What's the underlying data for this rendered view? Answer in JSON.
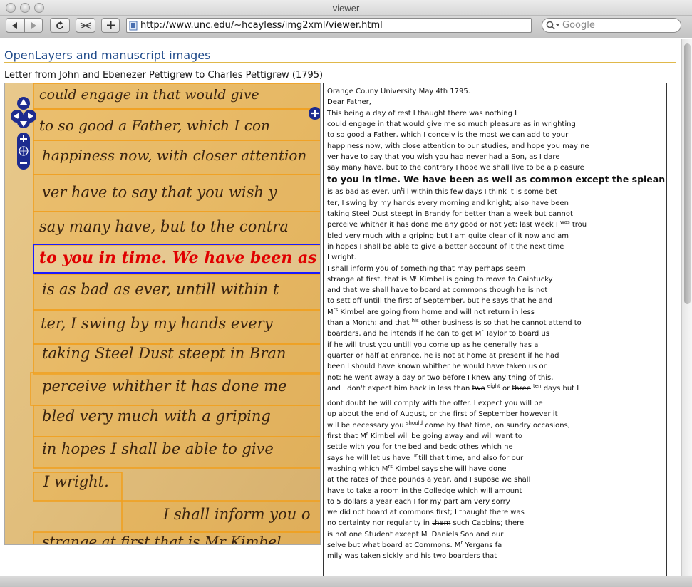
{
  "window": {
    "title": "viewer"
  },
  "toolbar": {
    "url": "http://www.unc.edu/~hcayless/img2xml/viewer.html",
    "search_placeholder": "Google"
  },
  "page": {
    "heading": "OpenLayers and manuscript images",
    "subtitle": "Letter from John and Ebenezer Pettigrew to Charles Pettigrew (1795)"
  },
  "manuscript": {
    "lines": [
      "could engage in that would give",
      "to so good a Father, which I con",
      "happiness now, with closer attention",
      "ver have to say that you wish y",
      "say many have, but to the contra",
      "to you in time. We have been as w",
      "is as bad as ever, untill within t",
      "ter, I swing by my hands every",
      "taking Steel Dust steept in Bran",
      "perceive whither it has done me",
      "bled very much with a griping",
      "in hopes I shall be able to give",
      "I wright.",
      "I shall inform you o",
      "strange at first that is Mr Kimbel"
    ]
  },
  "transcript": {
    "block1": [
      "Orange Couny University May 4th 1795.",
      "Dear Father,",
      "This being a day of rest I thaught there was nothing I",
      "could engage in that would give me so much pleasure as in wrighting",
      "to so good a Father, which I conceiv is the most we can add to your",
      "happiness now, with close attention to our studies, and hope you may ne",
      "ver have to say that you wish you had never had a Son, as I dare",
      "say many have, but to the contrary I hope we shall live to be a pleasure"
    ],
    "highlight": "to you in time. We have been as well as common except the splean which",
    "line_untill_a": "is as bad as ever, un",
    "line_untill_sup": "t",
    "line_untill_b": "ill within this few days I think it is some bet",
    "block2": [
      "ter, I swing by my hands every morning and knight; also have been",
      "taking Steel Dust steept in Brandy for better than a week but cannot"
    ],
    "line_was_a": "perceive whither it has done me any good or not yet; last week I ",
    "line_was_sup": "was",
    "line_was_b": " trou",
    "block3": [
      "bled very much with a griping but I am quite clear of it now and am",
      "in hopes I shall be able to give a better account of it the next time",
      "I wright.",
      "I shall inform you of something that may perhaps seem"
    ],
    "line_kimbel_a": "strange at first, that is M",
    "line_kimbel_sup": "r",
    "line_kimbel_b": " Kimbel is going to move to Caintucky",
    "block4": [
      "and that we shall have to board at commons though he is not",
      "to sett off untill the first of September, but he says that he and"
    ],
    "line_mrs_a": "M",
    "line_mrs_sup": "rs",
    "line_mrs_b": " Kimbel are going from home and will not return in less",
    "line_his_a": "than a Month: and that ",
    "line_his_sup": "his",
    "line_his_b": " other business is so that he cannot attend to",
    "line_taylor_a": "boarders, and he intends if he can to get M",
    "line_taylor_sup": "r",
    "line_taylor_b": " Taylor to board us",
    "block5": [
      "if he will trust you untill you come up as he generally has a",
      "quarter or half at enrance, he is not at home at present if he had",
      "been I should have known whither he would have taken us or",
      "not; he went away a day or two before I knew any thing of this,"
    ],
    "line_two_a": "and I don't expect him back in less than ",
    "line_two_strike": "two",
    "line_two_sup1": "eight",
    "line_two_mid": " or ",
    "line_two_strike2": "three",
    "line_two_sup2": "ten",
    "line_two_b": " days but I",
    "block6": [
      "dont doubt he will comply with the offer. I expect you will be",
      "up about the end of August, or the first of September however it"
    ],
    "line_should_a": "will be necessary you ",
    "line_should_sup": "should",
    "line_should_b": " come by that time, on sundry occasions,",
    "line_first_a": "first that M",
    "line_first_sup": "r",
    "line_first_b": " Kimbel will be going away and will want to",
    "block7": [
      "settle with you for the bed and bedclothes which he"
    ],
    "line_un_a": "says he will let us have ",
    "line_un_sup": "un",
    "line_un_b": "till that time, and also for our",
    "line_wash_a": "washing which M",
    "line_wash_sup": "rs",
    "line_wash_b": " Kimbel says she will have done",
    "block8": [
      "at the rates of thee pounds a year, and I supose we shall",
      "have to take a room in the Colledge which will amount",
      "to 5 dollars a year each I for my part am very sorry",
      "we did not board at commons first; I thaught there was"
    ],
    "line_them_a": "no certainty nor regularity in ",
    "line_them_strike": "them",
    "line_them_b": " such Cabbins; there",
    "line_daniels_a": "is not one Student except M",
    "line_daniels_sup": "r",
    "line_daniels_b": " Daniels Son and our",
    "line_yergans_a": "selve but what board at Commons. M",
    "line_yergans_sup": "r",
    "line_yergans_b": " Yergans fa",
    "block9": [
      "mily was taken sickly and his two boarders that"
    ]
  },
  "colors": {
    "heading": "#1f4a8a",
    "highlight_box": "#1a1aff",
    "line_box": "#f0a020",
    "ink": "#3a2410",
    "highlight_ink": "#e00000"
  }
}
